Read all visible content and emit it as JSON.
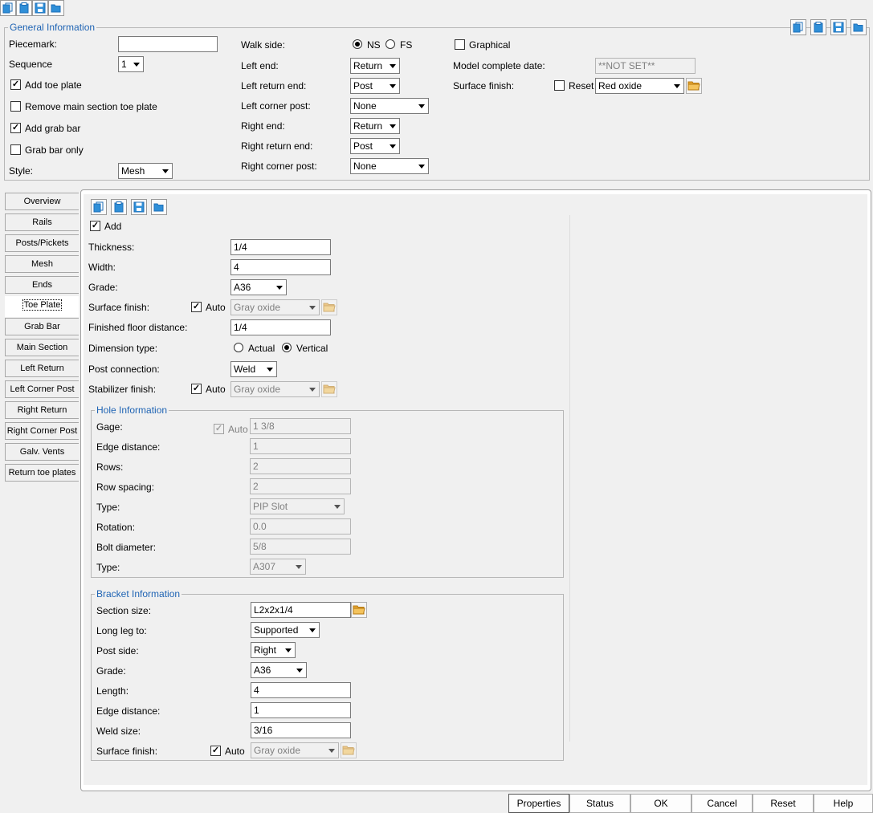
{
  "general": {
    "title": "General Information",
    "piecemark_label": "Piecemark:",
    "piecemark_value": "",
    "sequence_label": "Sequence",
    "sequence_value": "1",
    "add_toe_plate": "Add toe plate",
    "remove_main_toe": "Remove main section toe plate",
    "add_grab_bar": "Add grab bar",
    "grab_bar_only": "Grab bar only",
    "style_label": "Style:",
    "style_value": "Mesh",
    "walk_side_label": "Walk side:",
    "walk_ns": "NS",
    "walk_fs": "FS",
    "left_end_label": "Left end:",
    "left_end_value": "Return",
    "left_return_end_label": "Left return end:",
    "left_return_end_value": "Post",
    "left_corner_post_label": "Left corner post:",
    "left_corner_post_value": "None",
    "right_end_label": "Right end:",
    "right_end_value": "Return",
    "right_return_end_label": "Right return end:",
    "right_return_end_value": "Post",
    "right_corner_post_label": "Right corner post:",
    "right_corner_post_value": "None",
    "graphical": "Graphical",
    "model_complete_label": "Model complete date:",
    "model_complete_value": "**NOT SET**",
    "surface_finish_label": "Surface finish:",
    "reset": "Reset",
    "surface_finish_value": "Red oxide"
  },
  "tabs": [
    "Overview",
    "Rails",
    "Posts/Pickets",
    "Mesh",
    "Ends",
    "Toe Plate",
    "Grab Bar",
    "Main Section",
    "Left Return",
    "Left Corner Post",
    "Right Return",
    "Right Corner Post",
    "Galv. Vents",
    "Return toe plates"
  ],
  "toe": {
    "add": "Add",
    "thickness_label": "Thickness:",
    "thickness": "1/4",
    "width_label": "Width:",
    "width": "4",
    "grade_label": "Grade:",
    "grade": "A36",
    "surface_label": "Surface finish:",
    "auto": "Auto",
    "surface": "Gray oxide",
    "ffd_label": "Finished floor distance:",
    "ffd": "1/4",
    "dim_type_label": "Dimension type:",
    "actual": "Actual",
    "vertical": "Vertical",
    "post_conn_label": "Post connection:",
    "post_conn": "Weld",
    "stab_label": "Stabilizer finish:",
    "stab": "Gray oxide"
  },
  "hole": {
    "title": "Hole Information",
    "gage_label": "Gage:",
    "auto": "Auto",
    "gage": "1 3/8",
    "edge_label": "Edge distance:",
    "edge": "1",
    "rows_label": "Rows:",
    "rows": "2",
    "row_spacing_label": "Row spacing:",
    "row_spacing": "2",
    "type_label": "Type:",
    "type": "PIP Slot",
    "rotation_label": "Rotation:",
    "rotation": "0.0",
    "bolt_label": "Bolt diameter:",
    "bolt": "5/8",
    "type2_label": "Type:",
    "type2": "A307"
  },
  "bracket": {
    "title": "Bracket Information",
    "section_label": "Section size:",
    "section": "L2x2x1/4",
    "long_leg_label": "Long leg to:",
    "long_leg": "Supported",
    "post_side_label": "Post side:",
    "post_side": "Right",
    "grade_label": "Grade:",
    "grade": "A36",
    "length_label": "Length:",
    "length": "4",
    "edge_label": "Edge distance:",
    "edge": "1",
    "weld_label": "Weld size:",
    "weld": "3/16",
    "surface_label": "Surface finish:",
    "auto": "Auto",
    "surface": "Gray oxide"
  },
  "buttons": {
    "properties": "Properties",
    "status": "Status",
    "ok": "OK",
    "cancel": "Cancel",
    "reset": "Reset",
    "help": "Help"
  },
  "icons": {
    "toolbar": [
      "copy-icon",
      "paste-icon",
      "save-icon",
      "open-folder-icon"
    ],
    "accent": "#1f64b4",
    "folder": "#e8a530"
  }
}
